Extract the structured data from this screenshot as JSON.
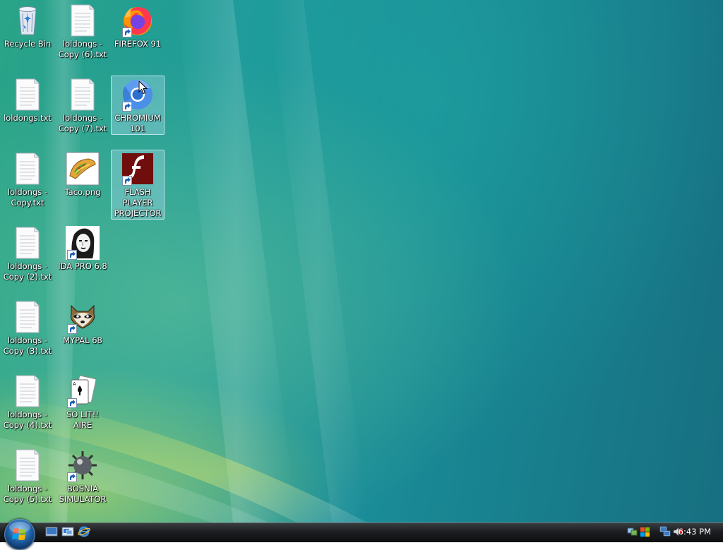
{
  "desktop": {
    "icons": [
      {
        "label": "Recycle Bin",
        "icon": "recycle-bin-icon"
      },
      {
        "label": "loldongs - Copy (6).txt",
        "icon": "text-file-icon"
      },
      {
        "label": "FIREFOX 91",
        "icon": "firefox-icon"
      },
      {
        "label": "loldongs.txt",
        "icon": "text-file-icon"
      },
      {
        "label": "loldongs - Copy (7).txt",
        "icon": "text-file-icon"
      },
      {
        "label": "CHROMIUM 101",
        "icon": "chromium-icon"
      },
      {
        "label": "loldongs - Copy.txt",
        "icon": "text-file-icon"
      },
      {
        "label": "Taco.png",
        "icon": "taco-image-icon"
      },
      {
        "label": "FLASH PLAYER PROJECTOR",
        "icon": "flash-player-icon"
      },
      {
        "label": "loldongs - Copy (2).txt",
        "icon": "text-file-icon"
      },
      {
        "label": "IDA PRO 6.8",
        "icon": "ida-pro-icon"
      },
      {
        "label": "loldongs - Copy (3).txt",
        "icon": "text-file-icon"
      },
      {
        "label": "MYPAL 68",
        "icon": "mypal-raccoon-icon"
      },
      {
        "label": "loldongs - Copy (4).txt",
        "icon": "text-file-icon"
      },
      {
        "label": "SO LIT!! AIRE",
        "icon": "solitaire-cards-icon"
      },
      {
        "label": "loldongs - Copy (5).txt",
        "icon": "text-file-icon"
      },
      {
        "label": "BOSNIA SIMULATOR",
        "icon": "minesweeper-mine-icon"
      }
    ]
  },
  "taskbar": {
    "start_button": "windows-orb-icon",
    "quick_launch": [
      "show-desktop-icon",
      "switch-windows-icon",
      "internet-explorer-icon"
    ],
    "tray_icons": [
      "network-icon",
      "windows-update-icon",
      "network-connection-icon",
      "volume-muted-icon"
    ],
    "clock": "6:43 PM"
  },
  "colors": {
    "wallpaper_accent": "#1f9a9a",
    "selection": "#bee6ff",
    "taskbar": "#1c1e21"
  }
}
